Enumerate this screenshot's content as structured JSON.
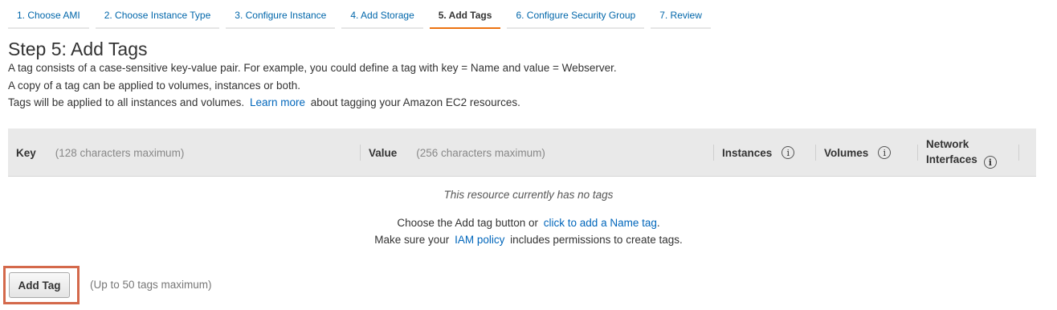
{
  "wizard": {
    "tabs": [
      {
        "label": "1. Choose AMI"
      },
      {
        "label": "2. Choose Instance Type"
      },
      {
        "label": "3. Configure Instance"
      },
      {
        "label": "4. Add Storage"
      },
      {
        "label": "5. Add Tags"
      },
      {
        "label": "6. Configure Security Group"
      },
      {
        "label": "7. Review"
      }
    ],
    "active_index": 4,
    "accent_color": "#ec7211"
  },
  "page": {
    "title": "Step 5: Add Tags",
    "desc_line1": "A tag consists of a case-sensitive key-value pair. For example, you could define a tag with key = Name and value = Webserver.",
    "desc_line2": "A copy of a tag can be applied to volumes, instances or both.",
    "desc_line3_prefix": "Tags will be applied to all instances and volumes.",
    "desc_line3_link": "Learn more",
    "desc_line3_suffix": "about tagging your Amazon EC2 resources."
  },
  "table": {
    "columns": {
      "key": {
        "label": "Key",
        "hint": "(128 characters maximum)"
      },
      "value": {
        "label": "Value",
        "hint": "(256 characters maximum)"
      },
      "instances": {
        "label": "Instances",
        "icon": "info-icon"
      },
      "volumes": {
        "label": "Volumes",
        "icon": "info-icon"
      },
      "network_interfaces": {
        "label_line1": "Network",
        "label_line2": "Interfaces",
        "icon": "info-icon"
      }
    },
    "info_glyph": "i"
  },
  "empty_state": {
    "message": "This resource currently has no tags",
    "line1_prefix": "Choose the Add tag button or",
    "line1_link": "click to add a Name tag",
    "line1_suffix": ".",
    "line2_prefix": "Make sure your",
    "line2_link": "IAM policy",
    "line2_suffix": "includes permissions to create tags."
  },
  "actions": {
    "add_tag_label": "Add Tag",
    "max_note": "(Up to 50 tags maximum)",
    "highlight_color": "#d4694b"
  }
}
